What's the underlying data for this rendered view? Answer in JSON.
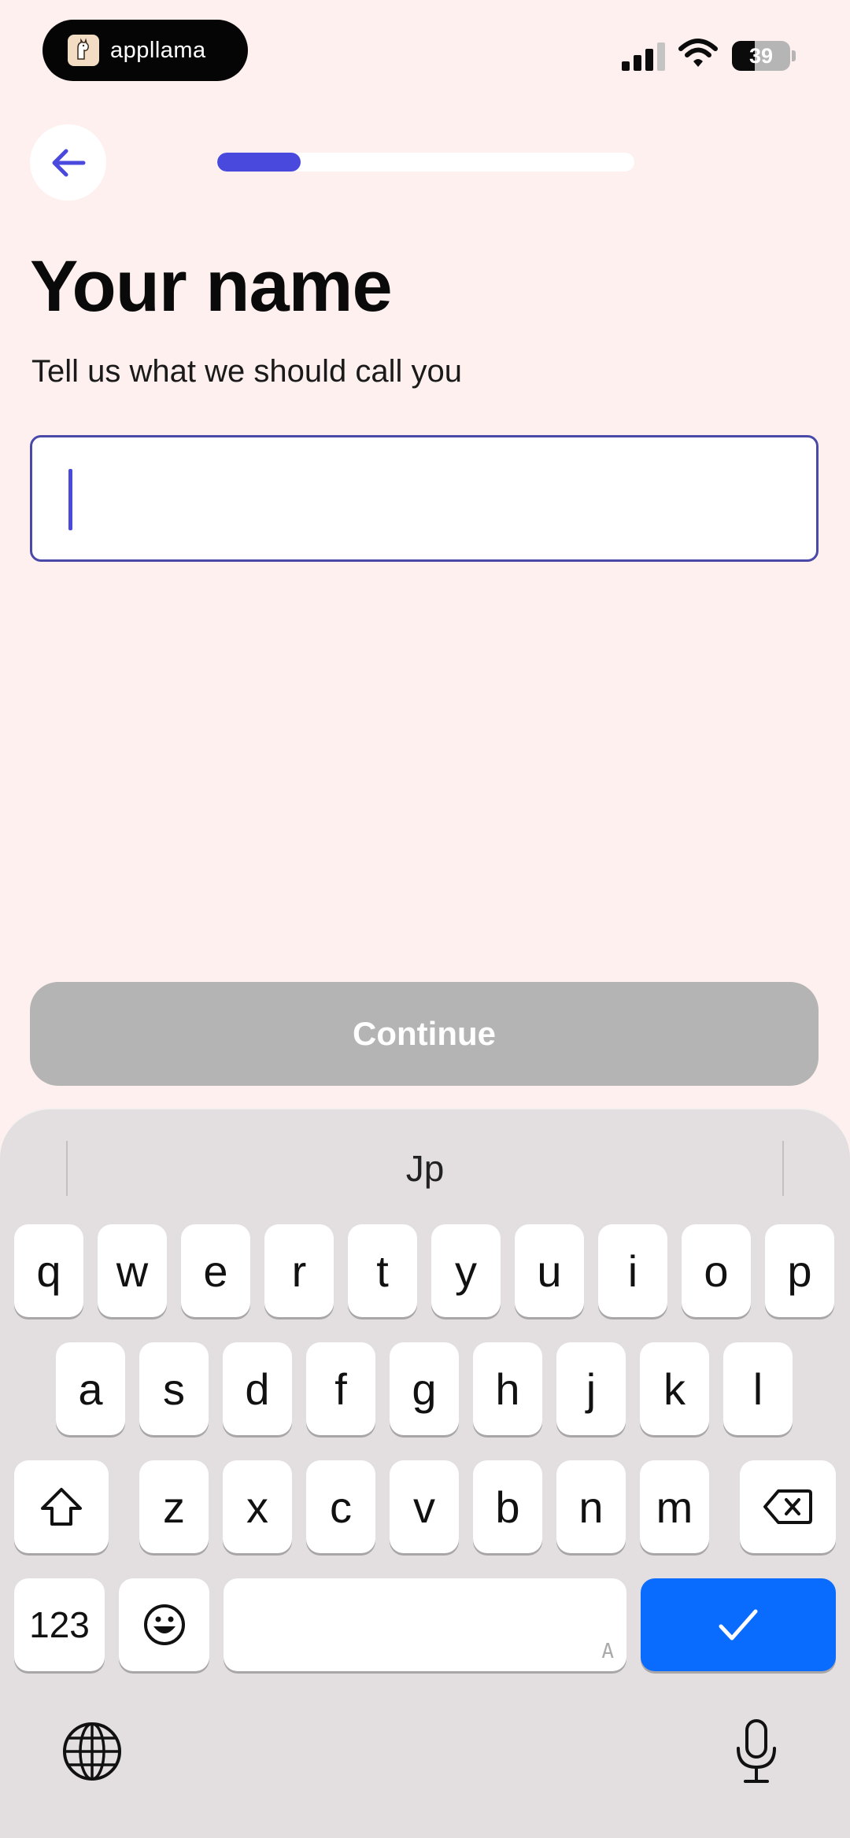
{
  "status_bar": {
    "app_name": "appllama",
    "app_logo_icon": "llama-icon",
    "battery_level": "39",
    "battery_fraction": 0.39,
    "signal_bars": 3
  },
  "header": {
    "back_icon": "arrow-left-icon",
    "progress_fraction": 0.2,
    "accent_color": "#4a49de"
  },
  "main": {
    "title": "Your name",
    "subtitle": "Tell us what we should call you",
    "name_input": {
      "value": "",
      "placeholder": ""
    },
    "continue_label": "Continue",
    "continue_enabled": false
  },
  "keyboard": {
    "suggestion": "Jp",
    "row1": [
      "q",
      "w",
      "e",
      "r",
      "t",
      "y",
      "u",
      "i",
      "o",
      "p"
    ],
    "row2": [
      "a",
      "s",
      "d",
      "f",
      "g",
      "h",
      "j",
      "k",
      "l"
    ],
    "row3": [
      "z",
      "x",
      "c",
      "v",
      "b",
      "n",
      "m"
    ],
    "numbers_label": "123",
    "space_hint": "A",
    "enter_color": "#0a6bff",
    "icons": [
      "shift-icon",
      "backspace-icon",
      "emoji-icon",
      "checkmark-icon",
      "globe-icon",
      "microphone-icon"
    ]
  }
}
